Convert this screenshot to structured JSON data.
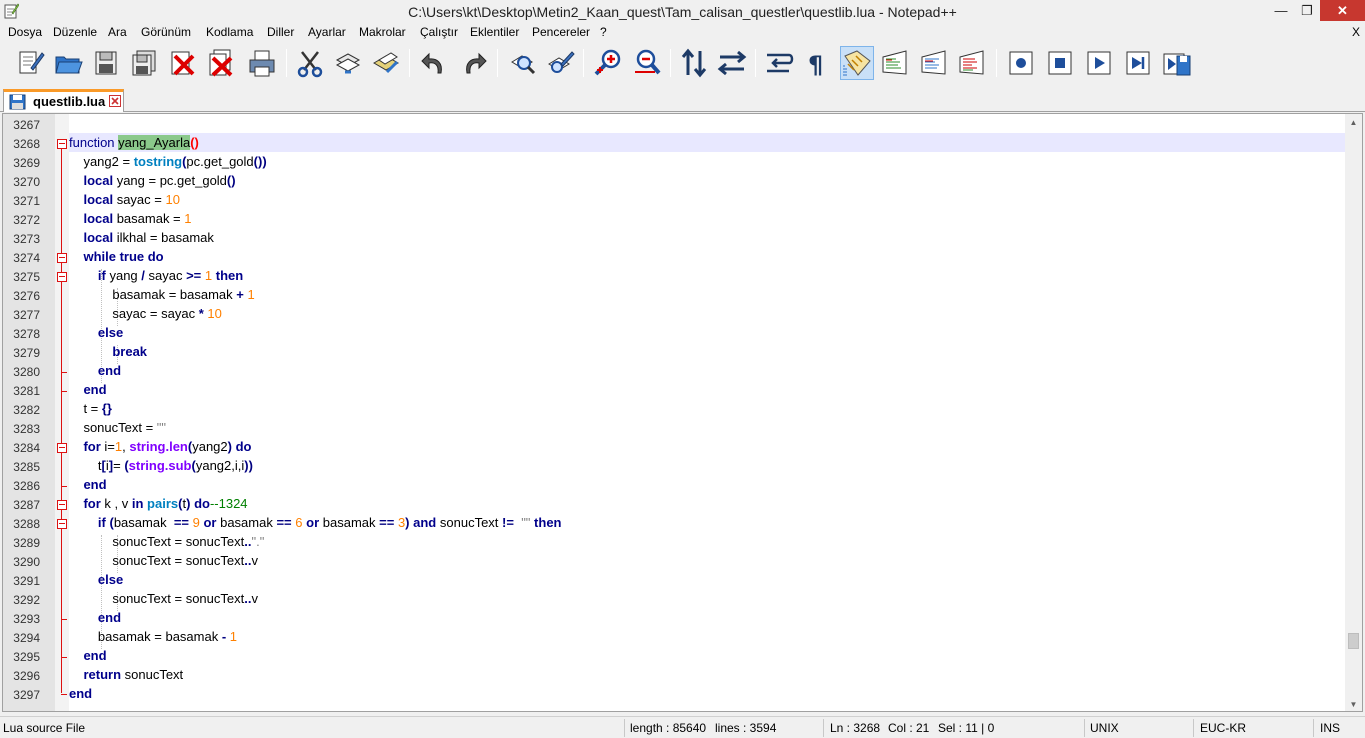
{
  "window": {
    "title": "C:\\Users\\kt\\Desktop\\Metin2_Kaan_quest\\Tam_calisan_questler\\questlib.lua - Notepad++",
    "minimize": "—",
    "maximize": "❐",
    "close": "✕"
  },
  "menu": {
    "items": [
      "Dosya",
      "Düzenle",
      "Ara",
      "Görünüm",
      "Kodlama",
      "Diller",
      "Ayarlar",
      "Makrolar",
      "Çalıştır",
      "Eklentiler",
      "Pencereler",
      "?"
    ],
    "close": "X"
  },
  "toolbar": {
    "buttons": [
      "new-file",
      "open-file",
      "save",
      "save-all",
      "close",
      "close-all",
      "print",
      "cut",
      "copy",
      "paste",
      "undo",
      "redo",
      "find",
      "replace",
      "zoom-in",
      "zoom-out",
      "sync-vertical",
      "sync-horizontal",
      "word-wrap",
      "show-all-chars",
      "indent-guide",
      "user-language",
      "doc-map",
      "function-list",
      "record-macro",
      "stop-macro",
      "play-macro",
      "run-macro-multiple",
      "save-macro"
    ],
    "active": "indent-guide"
  },
  "tab": {
    "label": "questlib.lua"
  },
  "editor": {
    "line_numbers": [
      "3267",
      "3268",
      "3269",
      "3270",
      "3271",
      "3272",
      "3273",
      "3274",
      "3275",
      "3276",
      "3277",
      "3278",
      "3279",
      "3280",
      "3281",
      "3282",
      "3283",
      "3284",
      "3285",
      "3286",
      "3287",
      "3288",
      "3289",
      "3290",
      "3291",
      "3292",
      "3293",
      "3294",
      "3295",
      "3296",
      "3297"
    ],
    "current_line": "3268"
  },
  "status": {
    "filetype": "Lua source File",
    "length": "length : 85640",
    "lines": "lines : 3594",
    "ln": "Ln : 3268",
    "col": "Col : 21",
    "sel": "Sel : 11 | 0",
    "eol": "UNIX",
    "encoding": "EUC-KR",
    "mode": "INS"
  },
  "colors": {
    "keyword": "#00008b",
    "number": "#ff8000",
    "library": "#8000ff",
    "builtin": "#0080c0",
    "fold": "#dd1111",
    "tab_accent": "#fa9a28",
    "current_line": "#e8e8ff",
    "highlight": "#8bc98b"
  }
}
